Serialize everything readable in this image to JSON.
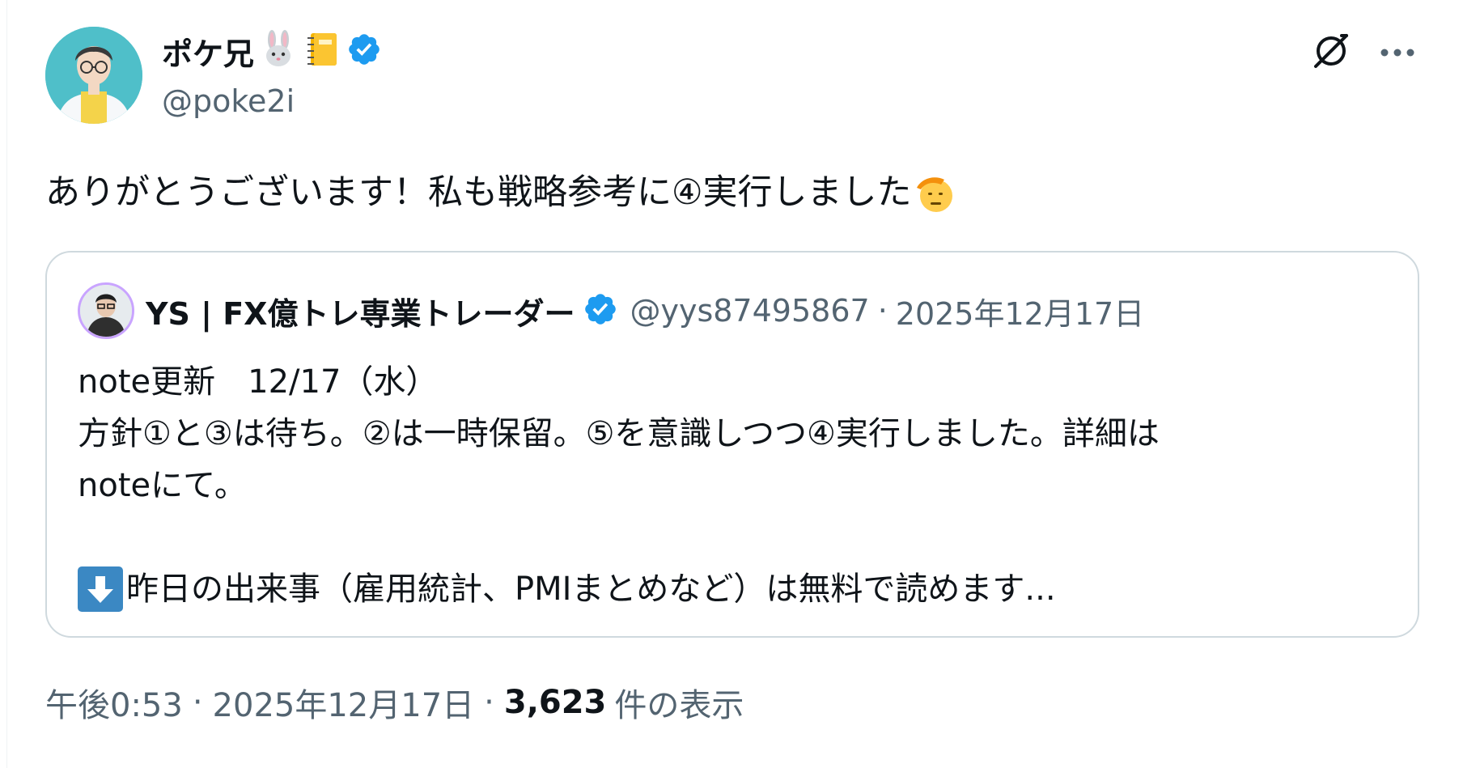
{
  "author": {
    "display_name": "ポケ兄",
    "name_emojis": [
      "rabbit-face-icon",
      "notebook-icon"
    ],
    "handle": "@poke2i",
    "verified": true
  },
  "tweet": {
    "text": "ありがとうございます！私も戦略参考に④実行しました",
    "trailing_emoji": "saluting-face-icon"
  },
  "quote": {
    "author_name": "YS | FX億トレ専業トレーダー",
    "verified": true,
    "handle": "@yys87495867",
    "separator": "·",
    "date": "2025年12月17日",
    "lines": [
      "note更新　12/17（水）",
      "方針①と③は待ち。②は一時保留。⑤を意識しつつ④実行しました。詳細は",
      "noteにて。",
      "",
      "昨日の出来事（雇用統計、PMIまとめなど）は無料で読めます..."
    ],
    "last_line_icon": "down-arrow-icon"
  },
  "meta": {
    "time": "午後0:53",
    "separator": "·",
    "date": "2025年12月17日",
    "views_count": "3,623",
    "views_label": "件の表示"
  },
  "colors": {
    "text_primary": "#0f1419",
    "text_secondary": "#536471",
    "verified_blue": "#1d9bf0",
    "border": "#cfd9de",
    "arrow_box": "#3b88c3"
  }
}
